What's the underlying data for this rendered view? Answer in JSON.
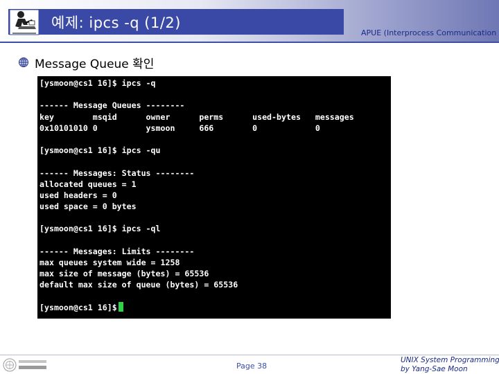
{
  "header": {
    "title": "예제: ipcs -q (1/2)",
    "subject": "APUE (Interprocess Communication"
  },
  "bullet": {
    "text": "Message Queue 확인"
  },
  "terminal": {
    "lines": [
      "[ysmoon@cs1 16]$ ipcs -q",
      "",
      "------ Message Queues --------",
      "key        msqid      owner      perms      used-bytes   messages",
      "0x10101010 0          ysmoon     666        0            0",
      "",
      "[ysmoon@cs1 16]$ ipcs -qu",
      "",
      "------ Messages: Status --------",
      "allocated queues = 1",
      "used headers = 0",
      "used space = 0 bytes",
      "",
      "[ysmoon@cs1 16]$ ipcs -ql",
      "",
      "------ Messages: Limits --------",
      "max queues system wide = 1258",
      "max size of message (bytes) = 65536",
      "default max size of queue (bytes) = 65536",
      "",
      "[ysmoon@cs1 16]$"
    ],
    "cursor_color": "#2fd24a"
  },
  "footer": {
    "page": "Page 38",
    "course_line1": "UNIX System Programming",
    "course_line2": "by Yang-Sae Moon"
  },
  "colors": {
    "title_bar": "#3a49a6",
    "accent_text": "#1a2a8a",
    "terminal_bg": "#000000"
  },
  "icons": {
    "header_logo": "professor-at-desk-icon",
    "bullet": "bullet-globe-icon",
    "footer_logo": "university-logo-icon"
  }
}
